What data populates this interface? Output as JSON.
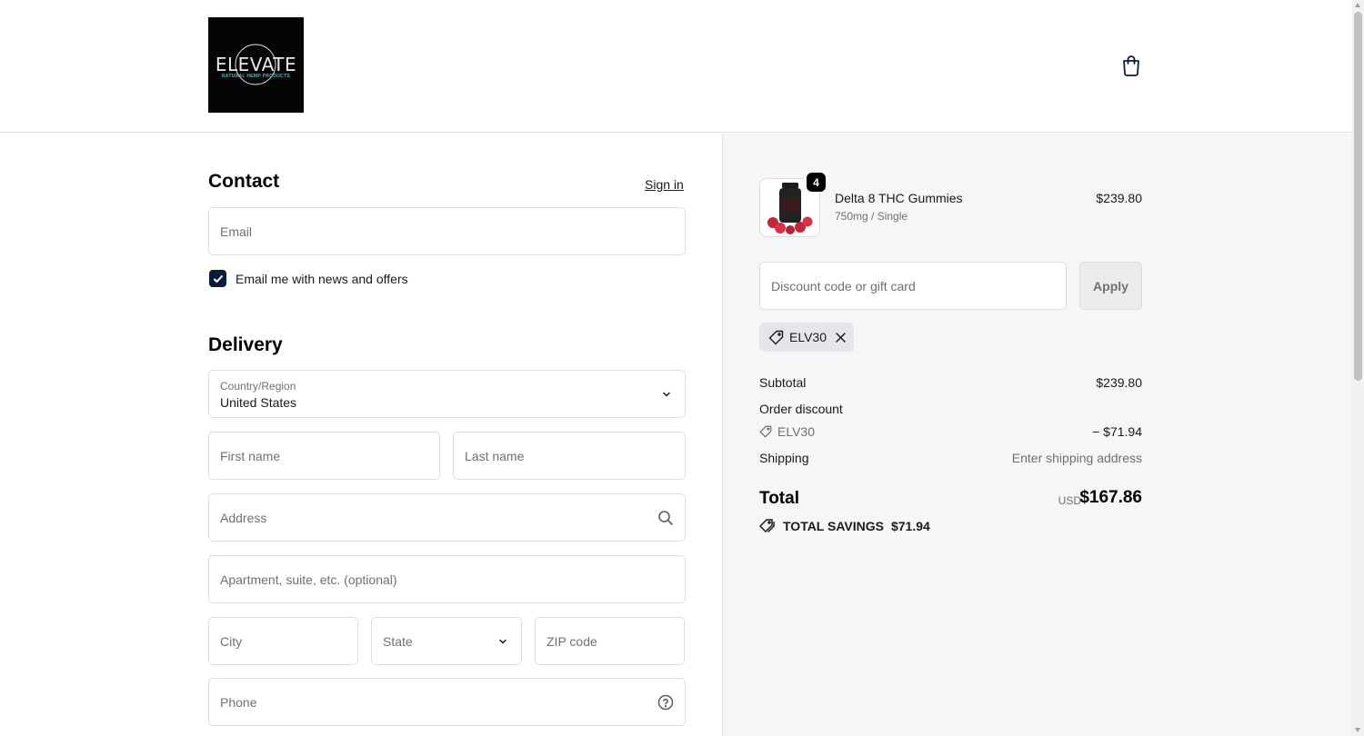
{
  "header": {
    "logo_text": "ELEVATE",
    "logo_subtext": "NATURAL HEMP PRODUCTS",
    "cart_icon": "shopping-bag-icon"
  },
  "contact": {
    "title": "Contact",
    "sign_in": "Sign in",
    "email_placeholder": "Email",
    "newsletter_label": "Email me with news and offers",
    "newsletter_checked": true
  },
  "delivery": {
    "title": "Delivery",
    "country_label": "Country/Region",
    "country_value": "United States",
    "first_name_placeholder": "First name",
    "last_name_placeholder": "Last name",
    "address_placeholder": "Address",
    "apartment_placeholder": "Apartment, suite, etc. (optional)",
    "city_placeholder": "City",
    "state_placeholder": "State",
    "zip_placeholder": "ZIP code",
    "phone_placeholder": "Phone"
  },
  "order": {
    "item": {
      "name": "Delta 8 THC Gummies",
      "variant": "750mg / Single",
      "price": "$239.80",
      "quantity": "4"
    },
    "discount_placeholder": "Discount code or gift card",
    "apply_label": "Apply",
    "applied_code": "ELV30",
    "subtotal_label": "Subtotal",
    "subtotal_value": "$239.80",
    "order_discount_label": "Order discount",
    "discount_code": "ELV30",
    "discount_value": "− $71.94",
    "shipping_label": "Shipping",
    "shipping_value": "Enter shipping address",
    "total_label": "Total",
    "total_currency": "USD",
    "total_value": "$167.86",
    "savings_label": "TOTAL SAVINGS",
    "savings_value": "$71.94"
  },
  "colors": {
    "checkbox": "#0b1e38",
    "sidebar_bg": "#f5f6f8"
  }
}
